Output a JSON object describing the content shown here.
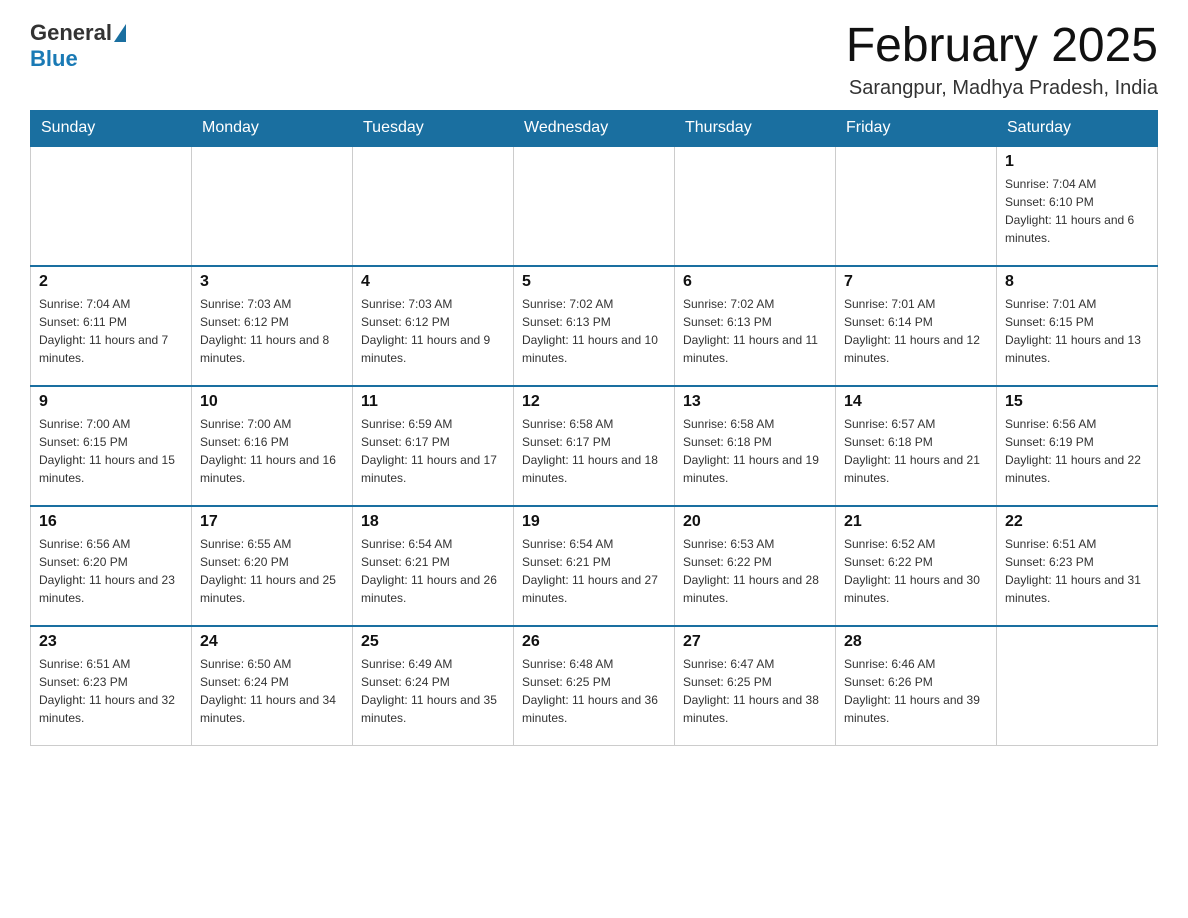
{
  "header": {
    "logo_general": "General",
    "logo_blue": "Blue",
    "month_title": "February 2025",
    "location": "Sarangpur, Madhya Pradesh, India"
  },
  "weekdays": [
    "Sunday",
    "Monday",
    "Tuesday",
    "Wednesday",
    "Thursday",
    "Friday",
    "Saturday"
  ],
  "weeks": [
    [
      {
        "day": "",
        "info": ""
      },
      {
        "day": "",
        "info": ""
      },
      {
        "day": "",
        "info": ""
      },
      {
        "day": "",
        "info": ""
      },
      {
        "day": "",
        "info": ""
      },
      {
        "day": "",
        "info": ""
      },
      {
        "day": "1",
        "info": "Sunrise: 7:04 AM\nSunset: 6:10 PM\nDaylight: 11 hours and 6 minutes."
      }
    ],
    [
      {
        "day": "2",
        "info": "Sunrise: 7:04 AM\nSunset: 6:11 PM\nDaylight: 11 hours and 7 minutes."
      },
      {
        "day": "3",
        "info": "Sunrise: 7:03 AM\nSunset: 6:12 PM\nDaylight: 11 hours and 8 minutes."
      },
      {
        "day": "4",
        "info": "Sunrise: 7:03 AM\nSunset: 6:12 PM\nDaylight: 11 hours and 9 minutes."
      },
      {
        "day": "5",
        "info": "Sunrise: 7:02 AM\nSunset: 6:13 PM\nDaylight: 11 hours and 10 minutes."
      },
      {
        "day": "6",
        "info": "Sunrise: 7:02 AM\nSunset: 6:13 PM\nDaylight: 11 hours and 11 minutes."
      },
      {
        "day": "7",
        "info": "Sunrise: 7:01 AM\nSunset: 6:14 PM\nDaylight: 11 hours and 12 minutes."
      },
      {
        "day": "8",
        "info": "Sunrise: 7:01 AM\nSunset: 6:15 PM\nDaylight: 11 hours and 13 minutes."
      }
    ],
    [
      {
        "day": "9",
        "info": "Sunrise: 7:00 AM\nSunset: 6:15 PM\nDaylight: 11 hours and 15 minutes."
      },
      {
        "day": "10",
        "info": "Sunrise: 7:00 AM\nSunset: 6:16 PM\nDaylight: 11 hours and 16 minutes."
      },
      {
        "day": "11",
        "info": "Sunrise: 6:59 AM\nSunset: 6:17 PM\nDaylight: 11 hours and 17 minutes."
      },
      {
        "day": "12",
        "info": "Sunrise: 6:58 AM\nSunset: 6:17 PM\nDaylight: 11 hours and 18 minutes."
      },
      {
        "day": "13",
        "info": "Sunrise: 6:58 AM\nSunset: 6:18 PM\nDaylight: 11 hours and 19 minutes."
      },
      {
        "day": "14",
        "info": "Sunrise: 6:57 AM\nSunset: 6:18 PM\nDaylight: 11 hours and 21 minutes."
      },
      {
        "day": "15",
        "info": "Sunrise: 6:56 AM\nSunset: 6:19 PM\nDaylight: 11 hours and 22 minutes."
      }
    ],
    [
      {
        "day": "16",
        "info": "Sunrise: 6:56 AM\nSunset: 6:20 PM\nDaylight: 11 hours and 23 minutes."
      },
      {
        "day": "17",
        "info": "Sunrise: 6:55 AM\nSunset: 6:20 PM\nDaylight: 11 hours and 25 minutes."
      },
      {
        "day": "18",
        "info": "Sunrise: 6:54 AM\nSunset: 6:21 PM\nDaylight: 11 hours and 26 minutes."
      },
      {
        "day": "19",
        "info": "Sunrise: 6:54 AM\nSunset: 6:21 PM\nDaylight: 11 hours and 27 minutes."
      },
      {
        "day": "20",
        "info": "Sunrise: 6:53 AM\nSunset: 6:22 PM\nDaylight: 11 hours and 28 minutes."
      },
      {
        "day": "21",
        "info": "Sunrise: 6:52 AM\nSunset: 6:22 PM\nDaylight: 11 hours and 30 minutes."
      },
      {
        "day": "22",
        "info": "Sunrise: 6:51 AM\nSunset: 6:23 PM\nDaylight: 11 hours and 31 minutes."
      }
    ],
    [
      {
        "day": "23",
        "info": "Sunrise: 6:51 AM\nSunset: 6:23 PM\nDaylight: 11 hours and 32 minutes."
      },
      {
        "day": "24",
        "info": "Sunrise: 6:50 AM\nSunset: 6:24 PM\nDaylight: 11 hours and 34 minutes."
      },
      {
        "day": "25",
        "info": "Sunrise: 6:49 AM\nSunset: 6:24 PM\nDaylight: 11 hours and 35 minutes."
      },
      {
        "day": "26",
        "info": "Sunrise: 6:48 AM\nSunset: 6:25 PM\nDaylight: 11 hours and 36 minutes."
      },
      {
        "day": "27",
        "info": "Sunrise: 6:47 AM\nSunset: 6:25 PM\nDaylight: 11 hours and 38 minutes."
      },
      {
        "day": "28",
        "info": "Sunrise: 6:46 AM\nSunset: 6:26 PM\nDaylight: 11 hours and 39 minutes."
      },
      {
        "day": "",
        "info": ""
      }
    ]
  ]
}
